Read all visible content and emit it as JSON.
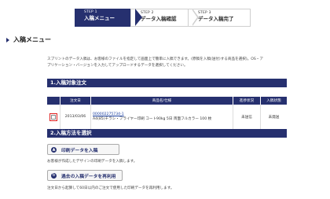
{
  "steps": [
    {
      "num": "STEP 1",
      "label": "入稿メニュー",
      "active": true
    },
    {
      "num": "STEP 2",
      "label": "データ入稿確認",
      "active": false
    },
    {
      "num": "STEP 3",
      "label": "データ入稿完了",
      "active": false
    }
  ],
  "page_title": "入稿メニュー",
  "intro_line1": "スプリントのデータ入稿は、お客様のファイルを指定して画面上で簡単に入稿できます。(原稿を入稿(送付)する商品を選択)。OS・ア",
  "intro_line2": "プリケーション・バージョンを入力してアップロードするデータを選択してください。",
  "section1_title": "1.入稿対象注文",
  "table": {
    "headers": [
      "",
      "注文日",
      "商品名/仕様",
      "進捗状況",
      "入稿状態"
    ],
    "rows": [
      {
        "date": "2013/03/06",
        "order_no": "000002275734-1",
        "spec": "A4(85)チラシ・フライヤー印刷 コート90kg 5日 両面フルカラー 100 枚",
        "progress": "未送信",
        "status": "未発送"
      }
    ]
  },
  "section2_title": "2.入稿方法を選択",
  "print_btn_label": "印刷データを入稿",
  "print_note": "お客様が作成したデザインの印刷データを入稿します。",
  "reuse_btn_label": "過去の入稿データを再利用",
  "reuse_note": "注文日から起算して60日以内のご注文で使用した印刷データを再利用します。",
  "colors": {
    "navy": "#26306f",
    "highlight": "#e02020"
  }
}
